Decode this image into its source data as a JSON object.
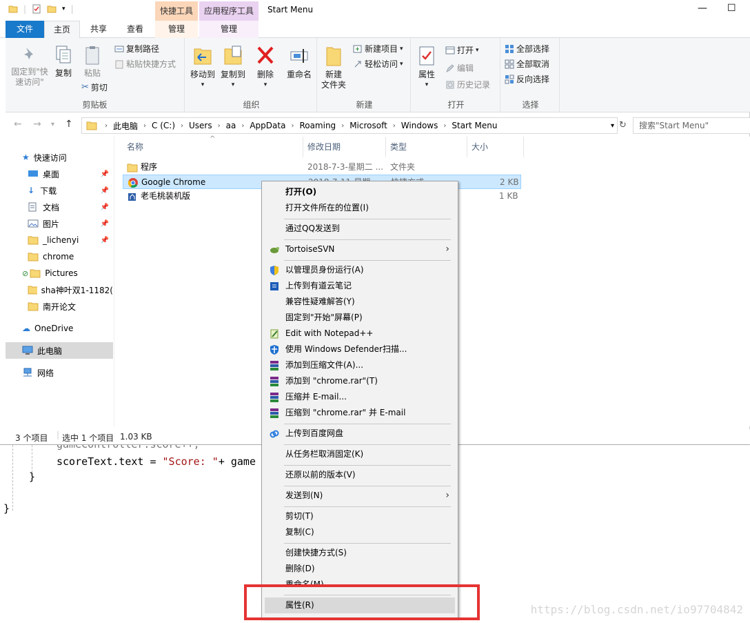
{
  "window": {
    "title": "Start Menu",
    "context_tab_headers": [
      "快捷工具",
      "应用程序工具"
    ],
    "tabs": [
      "文件",
      "主页",
      "共享",
      "查看",
      "管理",
      "管理"
    ],
    "minimize": "—",
    "maximize": "☐"
  },
  "ribbon": {
    "clipboard": {
      "label": "剪贴板",
      "pin": "固定到\"快速访问\"",
      "copy": "复制",
      "paste": "粘贴",
      "copy_path": "复制路径",
      "paste_shortcut": "粘贴快捷方式",
      "cut": "剪切"
    },
    "organize": {
      "label": "组织",
      "move_to": "移动到",
      "copy_to": "复制到",
      "delete": "删除",
      "rename": "重命名"
    },
    "new": {
      "label": "新建",
      "new_folder": "新建\n文件夹",
      "new_item": "新建项目",
      "easy_access": "轻松访问"
    },
    "open": {
      "label": "打开",
      "properties": "属性",
      "open": "打开",
      "edit": "编辑",
      "history": "历史记录"
    },
    "select": {
      "label": "选择",
      "select_all": "全部选择",
      "select_none": "全部取消",
      "invert": "反向选择"
    }
  },
  "address": {
    "crumbs": [
      "此电脑",
      "C (C:)",
      "Users",
      "aa",
      "AppData",
      "Roaming",
      "Microsoft",
      "Windows",
      "Start Menu"
    ],
    "search_placeholder": "搜索\"Start Menu\""
  },
  "nav": {
    "quick_access": "快速访问",
    "items": [
      "桌面",
      "下载",
      "文档",
      "图片",
      "_lichenyi",
      "chrome",
      "Pictures",
      "sha神叶双1-1182(",
      "南开论文"
    ],
    "onedrive": "OneDrive",
    "this_pc": "此电脑",
    "network": "网络"
  },
  "columns": [
    "名称",
    "修改日期",
    "类型",
    "大小"
  ],
  "files": [
    {
      "name": "程序",
      "date": "2018-7-3-星期二 ...",
      "type": "文件夹",
      "size": ""
    },
    {
      "name": "Google Chrome",
      "date": "2018-7-11-星期...",
      "type": "快捷方式",
      "size": "2 KB"
    },
    {
      "name": "老毛桃装机版",
      "date": "",
      "type": "",
      "size": "1 KB"
    }
  ],
  "status": {
    "count": "3 个项目",
    "selected": "选中 1 个项目",
    "size": "1.03 KB"
  },
  "context_menu": {
    "open": "打开(O)",
    "open_location": "打开文件所在的位置(I)",
    "qq_send": "通过QQ发送到",
    "tortoise": "TortoiseSVN",
    "run_admin": "以管理员身份运行(A)",
    "youdao": "上传到有道云笔记",
    "compat": "兼容性疑难解答(Y)",
    "pin_start": "固定到\"开始\"屏幕(P)",
    "notepad": "Edit with Notepad++",
    "defender": "使用 Windows Defender扫描...",
    "add_archive": "添加到压缩文件(A)...",
    "add_rar": "添加到 \"chrome.rar\"(T)",
    "compress_email": "压缩并 E-mail...",
    "compress_rar_email": "压缩到 \"chrome.rar\" 并 E-mail",
    "baidu": "上传到百度网盘",
    "unpin_taskbar": "从任务栏取消固定(K)",
    "restore": "还原以前的版本(V)",
    "send_to": "发送到(N)",
    "cut": "剪切(T)",
    "copy": "复制(C)",
    "create_shortcut": "创建快捷方式(S)",
    "delete": "删除(D)",
    "rename": "重命名(M)",
    "properties": "属性(R)"
  },
  "background": {
    "code_line1": "gameController.score++;",
    "code_line2_a": "scoreText.text = ",
    "code_line2_str": "\"Score: \"",
    "code_line2_b": "+ game",
    "brace1": "}",
    "brace2": "}"
  },
  "watermark": "https://blog.csdn.net/io97704842",
  "colors": {
    "file_tab": "#1979ca",
    "selection": "#cce8ff",
    "highlight_box": "#e53333"
  }
}
